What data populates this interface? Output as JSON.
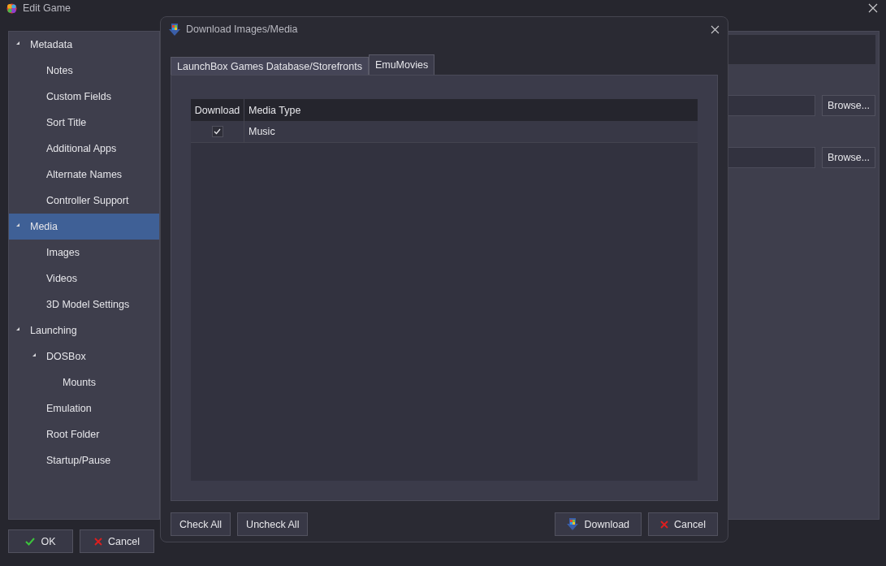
{
  "window": {
    "title": "Edit Game"
  },
  "sidebar": {
    "items": [
      {
        "label": "Metadata",
        "selected": false,
        "expanded": true,
        "children": [
          {
            "label": "Notes",
            "selected": false
          },
          {
            "label": "Custom Fields",
            "selected": false
          },
          {
            "label": "Sort Title",
            "selected": false
          },
          {
            "label": "Additional Apps",
            "selected": false
          },
          {
            "label": "Alternate Names",
            "selected": false
          },
          {
            "label": "Controller Support",
            "selected": false
          }
        ]
      },
      {
        "label": "Media",
        "selected": true,
        "expanded": true,
        "children": [
          {
            "label": "Images",
            "selected": false
          },
          {
            "label": "Videos",
            "selected": false
          },
          {
            "label": "3D Model Settings",
            "selected": false
          }
        ]
      },
      {
        "label": "Launching",
        "selected": false,
        "expanded": true,
        "children": [
          {
            "label": "DOSBox",
            "selected": false,
            "expanded": true,
            "children": [
              {
                "label": "Mounts",
                "selected": false
              }
            ]
          },
          {
            "label": "Emulation",
            "selected": false
          },
          {
            "label": "Root Folder",
            "selected": false
          },
          {
            "label": "Startup/Pause",
            "selected": false
          }
        ]
      }
    ]
  },
  "panel": {
    "browse_buttons": [
      "Browse...",
      "Browse..."
    ]
  },
  "buttons": [
    {
      "label": "OK",
      "kind": "ok"
    },
    {
      "label": "Cancel",
      "kind": "cancel"
    }
  ],
  "dialog": {
    "title": "Download Images/Media",
    "tabs": [
      {
        "label": "LaunchBox Games Database/Storefronts",
        "selected": false
      },
      {
        "label": "EmuMovies",
        "selected": true
      }
    ],
    "table": {
      "columns": [
        "Download",
        "Media Type"
      ],
      "rows": [
        {
          "checked": true,
          "media_type": "Music"
        }
      ]
    },
    "left_buttons": [
      "Check All",
      "Uncheck All"
    ],
    "right_buttons": [
      {
        "label": "Download",
        "kind": "download"
      },
      {
        "label": "Cancel",
        "kind": "cancel"
      }
    ]
  }
}
